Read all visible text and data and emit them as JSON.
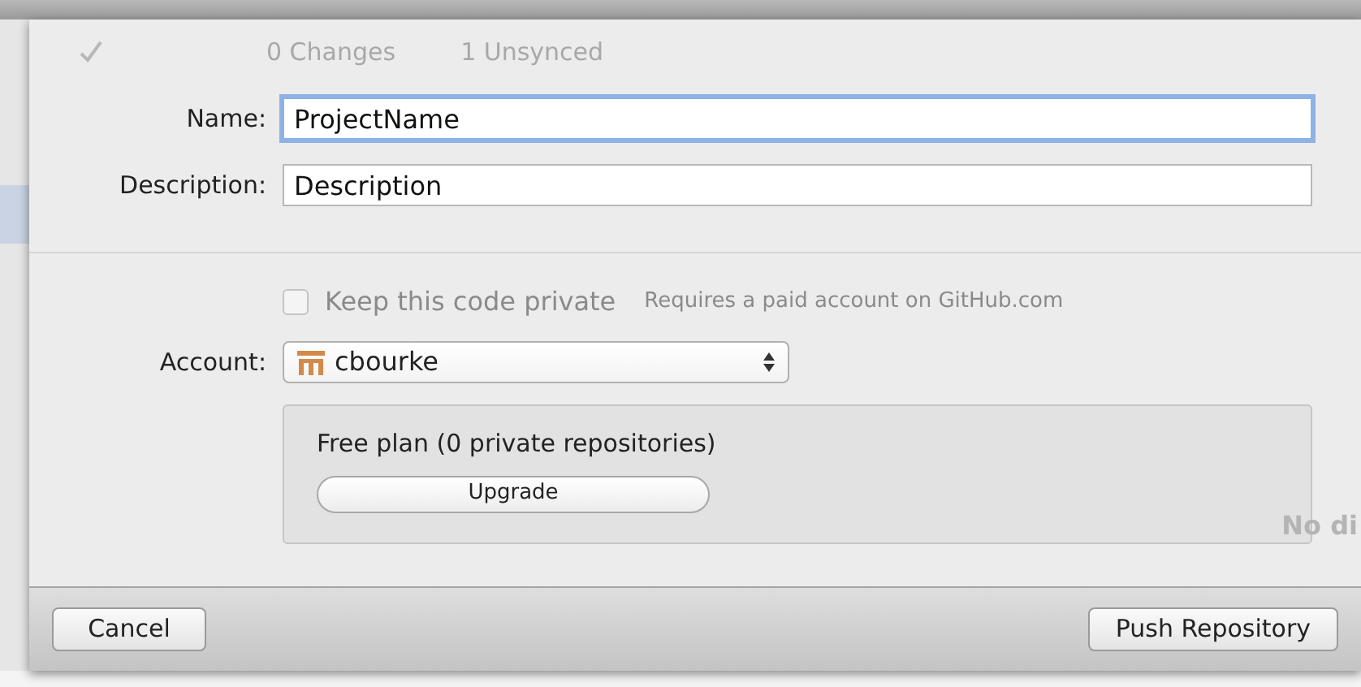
{
  "background": {
    "labels": [
      "0 Changes",
      "1 Unsynced"
    ],
    "side_text": "No di"
  },
  "fields": [
    {
      "label": "Name:",
      "value": "ProjectName",
      "focused": true
    },
    {
      "label": "Description:",
      "value": "Description",
      "focused": false
    }
  ],
  "private_option": {
    "label": "Keep this code private",
    "checked": false,
    "disabled": true,
    "note": "Requires a paid account on GitHub.com"
  },
  "account": {
    "label": "Account:",
    "value": "cbourke"
  },
  "plan": {
    "text": "Free plan (0 private repositories)",
    "button": "Upgrade"
  },
  "buttons": [
    {
      "label": "Cancel",
      "kind": "cancel"
    },
    {
      "label": "Push Repository",
      "kind": "confirm"
    }
  ]
}
